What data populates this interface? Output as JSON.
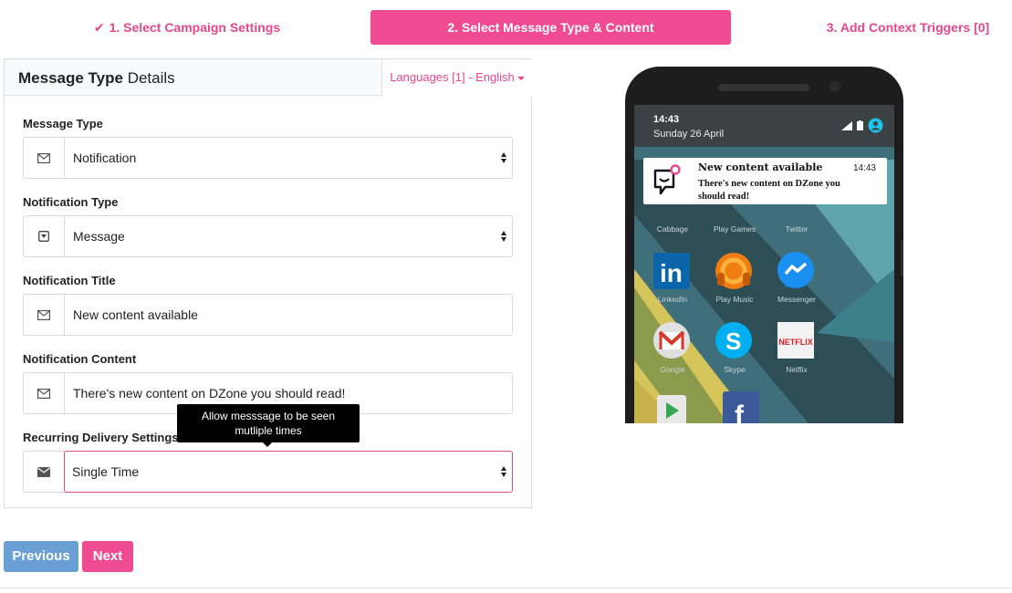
{
  "wizard": {
    "step1": "1. Select Campaign Settings",
    "step2": "2. Select Message Type & Content",
    "step3": "3. Add Context Triggers [0]"
  },
  "panel": {
    "title_bold": "Message Type",
    "title_rest": " Details",
    "language_tab": "Languages [1] - English"
  },
  "fields": {
    "message_type": {
      "label": "Message Type",
      "value": "Notification"
    },
    "notification_type": {
      "label": "Notification Type",
      "value": "Message"
    },
    "notification_title": {
      "label": "Notification Title",
      "value": "New content available"
    },
    "notification_content": {
      "label": "Notification Content",
      "value": "There's new content on DZone you should read!"
    },
    "recurring": {
      "label": "Recurring Delivery Settings",
      "value": "Single Time"
    }
  },
  "tooltip": {
    "line1": "Allow messsage to be seen",
    "line2": "mutliple times"
  },
  "buttons": {
    "previous": "Previous",
    "next": "Next"
  },
  "phone": {
    "status_time": "14:43",
    "status_date": "Sunday 26 April",
    "notification": {
      "title": "New content available",
      "time": "14:43",
      "body": "There's new content on DZone you should read!"
    },
    "apps": {
      "cabbage": "Cabbage",
      "play_games": "Play Games",
      "twitter": "Twitter",
      "linkedin": "LinkedIn",
      "play_music": "Play Music",
      "messenger": "Messenger",
      "google": "Google",
      "skype": "Skype",
      "netflix": "Netflix",
      "netflix_logo": "NETFLIX"
    }
  },
  "colors": {
    "accent": "#ef4b92",
    "accent_text": "#e8478c",
    "previous_button": "#6a9fd4"
  },
  "icons": {
    "step_done": "check-icon",
    "field_addon": "envelope-icon",
    "notification_type_addon": "dropdown-box-icon"
  }
}
